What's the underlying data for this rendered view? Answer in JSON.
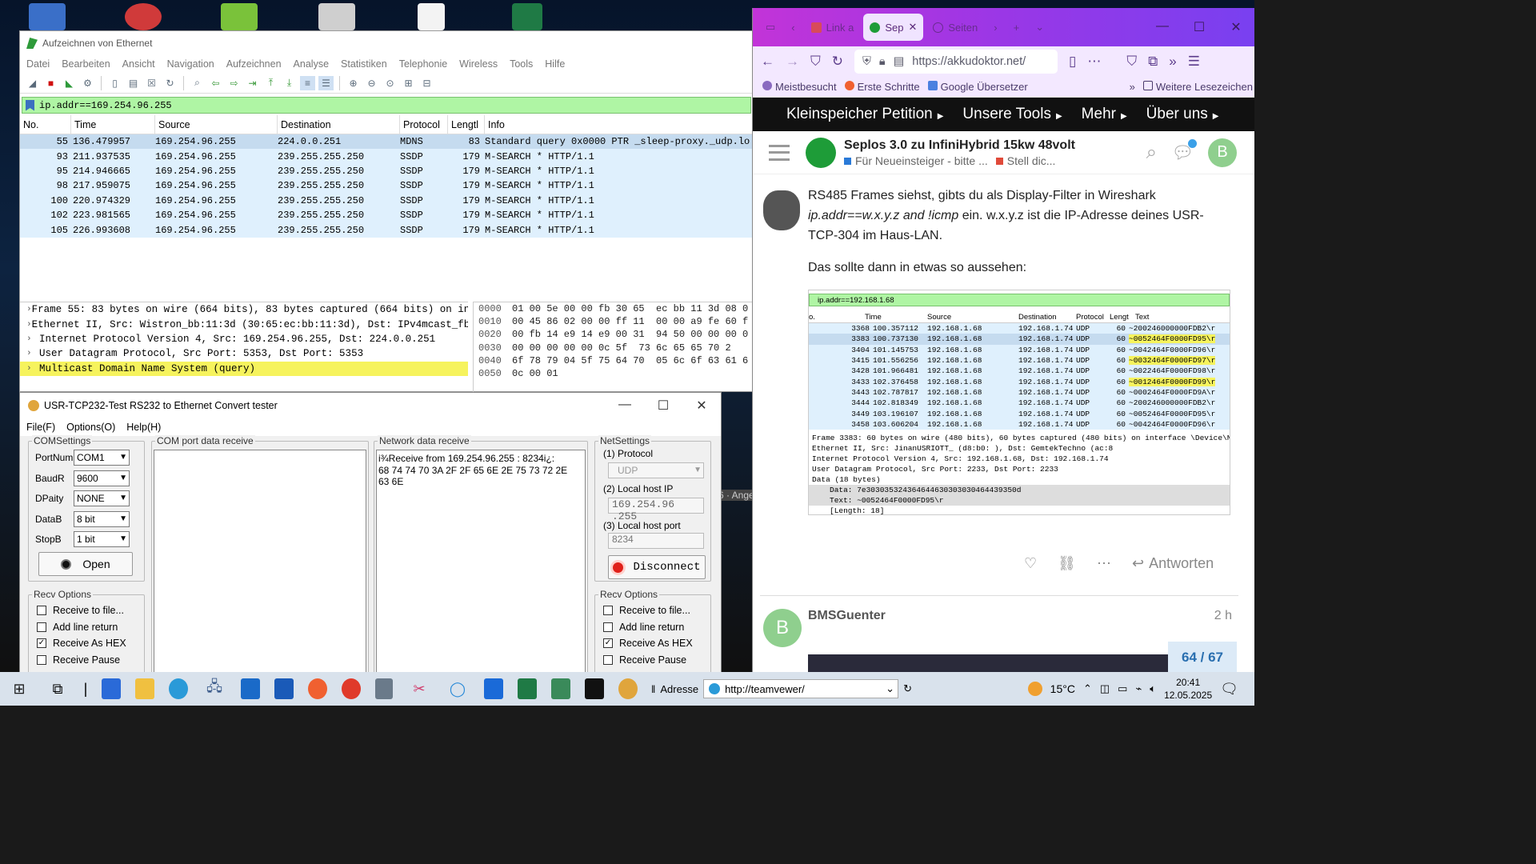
{
  "wireshark": {
    "title": "Aufzeichnen von Ethernet",
    "menu": [
      "Datei",
      "Bearbeiten",
      "Ansicht",
      "Navigation",
      "Aufzeichnen",
      "Analyse",
      "Statistiken",
      "Telephonie",
      "Wireless",
      "Tools",
      "Hilfe"
    ],
    "filter": "ip.addr==169.254.96.255",
    "columns": [
      "No.",
      "Time",
      "Source",
      "Destination",
      "Protocol",
      "Lengtl",
      "Info"
    ],
    "packets": [
      {
        "no": "55",
        "time": "136.479957",
        "src": "169.254.96.255",
        "dst": "224.0.0.251",
        "proto": "MDNS",
        "len": "83",
        "info": "Standard query 0x0000 PTR _sleep-proxy._udp.lo"
      },
      {
        "no": "93",
        "time": "211.937535",
        "src": "169.254.96.255",
        "dst": "239.255.255.250",
        "proto": "SSDP",
        "len": "179",
        "info": "M-SEARCH * HTTP/1.1"
      },
      {
        "no": "95",
        "time": "214.946665",
        "src": "169.254.96.255",
        "dst": "239.255.255.250",
        "proto": "SSDP",
        "len": "179",
        "info": "M-SEARCH * HTTP/1.1"
      },
      {
        "no": "98",
        "time": "217.959075",
        "src": "169.254.96.255",
        "dst": "239.255.255.250",
        "proto": "SSDP",
        "len": "179",
        "info": "M-SEARCH * HTTP/1.1"
      },
      {
        "no": "100",
        "time": "220.974329",
        "src": "169.254.96.255",
        "dst": "239.255.255.250",
        "proto": "SSDP",
        "len": "179",
        "info": "M-SEARCH * HTTP/1.1"
      },
      {
        "no": "102",
        "time": "223.981565",
        "src": "169.254.96.255",
        "dst": "239.255.255.250",
        "proto": "SSDP",
        "len": "179",
        "info": "M-SEARCH * HTTP/1.1"
      },
      {
        "no": "105",
        "time": "226.993608",
        "src": "169.254.96.255",
        "dst": "239.255.255.250",
        "proto": "SSDP",
        "len": "179",
        "info": "M-SEARCH * HTTP/1.1"
      }
    ],
    "details": [
      "Frame 55: 83 bytes on wire (664 bits), 83 bytes captured (664 bits) on in",
      "Ethernet II, Src: Wistron_bb:11:3d (30:65:ec:bb:11:3d), Dst: IPv4mcast_fb",
      "Internet Protocol Version 4, Src: 169.254.96.255, Dst: 224.0.0.251",
      "User Datagram Protocol, Src Port: 5353, Dst Port: 5353",
      "Multicast Domain Name System (query)"
    ],
    "hex": [
      {
        "off": "0000",
        "bytes": "01 00 5e 00 00 fb 30 65  ec bb 11 3d 08 0"
      },
      {
        "off": "0010",
        "bytes": "00 45 86 02 00 00 ff 11  00 00 a9 fe 60 f"
      },
      {
        "off": "0020",
        "bytes": "00 fb 14 e9 14 e9 00 31  94 50 00 00 00 0"
      },
      {
        "off": "0030",
        "bytes": "00 00 00 00 00 0c 5f  73 6c 65 65 70 2"
      },
      {
        "off": "0040",
        "bytes": "6f 78 79 04 5f 75 64 70  05 6c 6f 63 61 6"
      },
      {
        "off": "0050",
        "bytes": "0c 00 01"
      }
    ],
    "partial_label": "6 · Ange"
  },
  "usr": {
    "title": "USR-TCP232-Test  RS232 to Ethernet Convert tester",
    "menu": [
      "File(F)",
      "Options(O)",
      "Help(H)"
    ],
    "com_settings_label": "COMSettings",
    "fields": [
      {
        "label": "PortNum",
        "value": "COM1"
      },
      {
        "label": "BaudR",
        "value": "9600"
      },
      {
        "label": "DPaity",
        "value": "NONE"
      },
      {
        "label": "DataB",
        "value": "8 bit"
      },
      {
        "label": "StopB",
        "value": "1 bit"
      }
    ],
    "open_label": "Open",
    "com_receive_label": "COM port data receive",
    "net_receive_label": "Network data receive",
    "net_receive_text": "i¾Receive from 169.254.96.255 : 8234i¿:\n68 74 74 70 3A 2F 2F 65 6E 2E 75 73 72 2E\n63 6E",
    "net_settings_label": "NetSettings",
    "protocol_label": "(1) Protocol",
    "protocol_value": "UDP",
    "local_ip_label": "(2) Local host IP",
    "local_ip_value": "169.254.96 .255",
    "local_port_label": "(3) Local host port",
    "local_port_value": "8234",
    "disconnect_label": "Disconnect",
    "recv_options_label": "Recv Options",
    "recv_options": [
      {
        "label": "Receive to file...",
        "checked": false
      },
      {
        "label": "Add line return",
        "checked": false
      },
      {
        "label": "Receive As HEX",
        "checked": true
      },
      {
        "label": "Receive Pause",
        "checked": false
      }
    ],
    "check_mark": "✓"
  },
  "firefox": {
    "tabs": [
      {
        "label": "Link a"
      },
      {
        "label": "Sep"
      },
      {
        "label": "Seiten"
      }
    ],
    "url": "https://akkudoktor.net/",
    "bookmarks": [
      "Meistbesucht",
      "Erste Schritte",
      "Google Übersetzer",
      "Weitere Lesezeichen"
    ],
    "site_nav": [
      "Kleinspeicher Petition",
      "Unsere Tools",
      "Mehr",
      "Über uns"
    ],
    "topic_title": "Seplos 3.0 zu InfiniHybrid 15kw 48volt",
    "topic_cats": [
      "Für Neueinsteiger - bitte ...",
      "Stell dic..."
    ],
    "avatar_letter": "B",
    "post_p1_a": "RS485 Frames siehst, gibts du als Display-Filter in Wireshark ",
    "post_p1_b": "ip.addr==w.x.y.z and !icmp",
    "post_p1_c": " ein. w.x.y.z ist die IP-Adresse deines USR-TCP-304 im Haus-LAN.",
    "post_p2": "Das sollte dann in etwas so aussehen:",
    "reply_label": "Antworten",
    "next_author": "BMSGuenter",
    "next_time": "2 h",
    "progress": "64 / 67"
  },
  "embedded": {
    "filter": "ip.addr==192.168.1.68",
    "columns": [
      "o.",
      "Time",
      "Source",
      "Destination",
      "Protocol",
      "Lengt",
      "Text"
    ],
    "rows": [
      {
        "no": "3368",
        "time": "100.357112",
        "src": "192.168.1.68",
        "dst": "192.168.1.74",
        "pr": "UDP",
        "len": "60",
        "info": "~200246000000FDB2\\r",
        "yl": false
      },
      {
        "no": "3383",
        "time": "100.737130",
        "src": "192.168.1.68",
        "dst": "192.168.1.74",
        "pr": "UDP",
        "len": "60",
        "info": "~0052464F0000FD95\\r",
        "yl": true
      },
      {
        "no": "3404",
        "time": "101.145753",
        "src": "192.168.1.68",
        "dst": "192.168.1.74",
        "pr": "UDP",
        "len": "60",
        "info": "~0042464F0000FD96\\r",
        "yl": false
      },
      {
        "no": "3415",
        "time": "101.556256",
        "src": "192.168.1.68",
        "dst": "192.168.1.74",
        "pr": "UDP",
        "len": "60",
        "info": "~0032464F0000FD97\\r",
        "yl": true
      },
      {
        "no": "3428",
        "time": "101.966481",
        "src": "192.168.1.68",
        "dst": "192.168.1.74",
        "pr": "UDP",
        "len": "60",
        "info": "~0022464F0000FD98\\r",
        "yl": false
      },
      {
        "no": "3433",
        "time": "102.376458",
        "src": "192.168.1.68",
        "dst": "192.168.1.74",
        "pr": "UDP",
        "len": "60",
        "info": "~0012464F0000FD99\\r",
        "yl": true
      },
      {
        "no": "3443",
        "time": "102.787817",
        "src": "192.168.1.68",
        "dst": "192.168.1.74",
        "pr": "UDP",
        "len": "60",
        "info": "~0002464F0000FD9A\\r",
        "yl": false
      },
      {
        "no": "3444",
        "time": "102.818349",
        "src": "192.168.1.68",
        "dst": "192.168.1.74",
        "pr": "UDP",
        "len": "60",
        "info": "~200246000000FDB2\\r",
        "yl": false
      },
      {
        "no": "3449",
        "time": "103.196107",
        "src": "192.168.1.68",
        "dst": "192.168.1.74",
        "pr": "UDP",
        "len": "60",
        "info": "~0052464F0000FD95\\r",
        "yl": false
      },
      {
        "no": "3458",
        "time": "103.606204",
        "src": "192.168.1.68",
        "dst": "192.168.1.74",
        "pr": "UDP",
        "len": "60",
        "info": "~0042464F0000FD96\\r",
        "yl": false
      }
    ],
    "details": [
      "Frame 3383: 60 bytes on wire (480 bits), 60 bytes captured (480 bits) on interface \\Device\\NPF_",
      "Ethernet II, Src: JinanUSRIOTT_         (d8:b0:         ), Dst: GemtekTechno         (ac:8",
      "Internet Protocol Version 4, Src: 192.168.1.68, Dst: 192.168.1.74",
      "User Datagram Protocol, Src Port: 2233, Dst Port: 2233",
      "Data (18 bytes)"
    ],
    "data_sub": [
      "Data: 7e303035324364644630303030464439350d",
      "Text: ~0052464F0000FD95\\r",
      "[Length: 18]"
    ]
  },
  "taskbar": {
    "address_label": "Adresse",
    "address_value": "http://teamvewer/",
    "temperature": "15°C",
    "time": "20:41",
    "date": "12.05.2025"
  },
  "colors": {
    "filter_green": "#aff5a4",
    "row_blue": "#dff0fd",
    "highlight_yellow": "#f6f35d",
    "firefox_purple": "#9a37e6"
  }
}
